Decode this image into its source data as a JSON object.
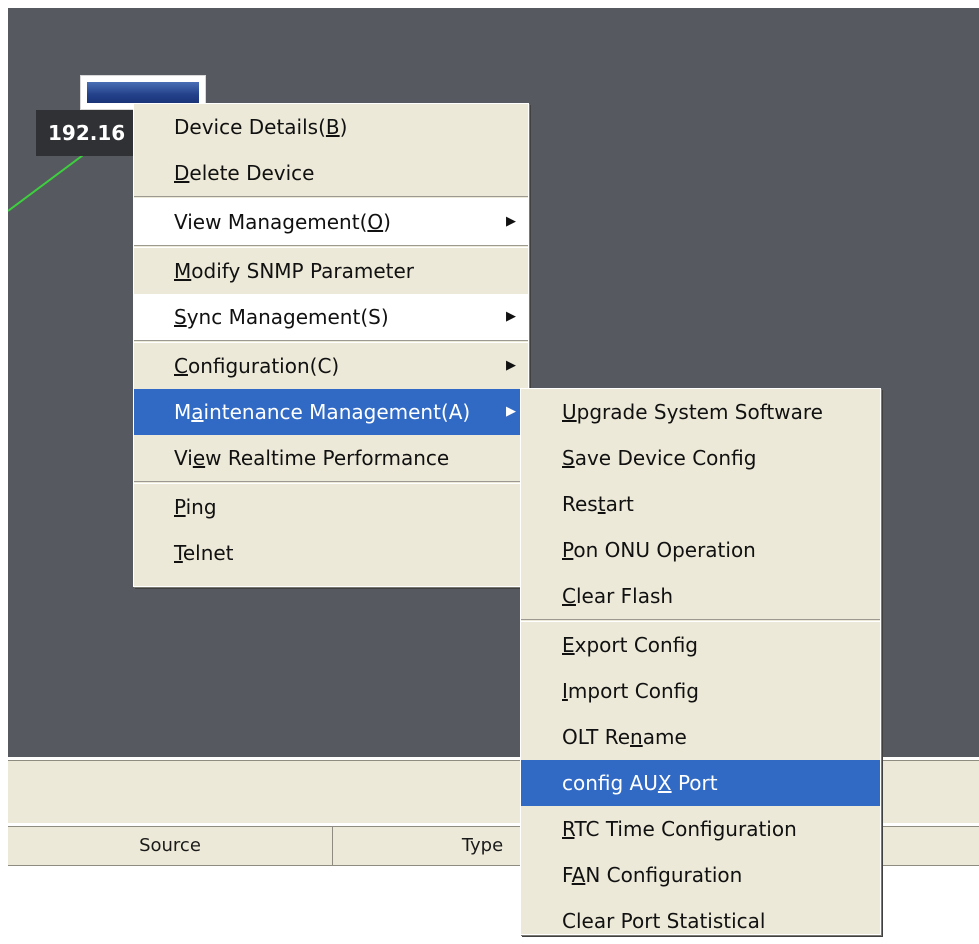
{
  "topology": {
    "device_label": "192.16"
  },
  "context_menu": {
    "items": [
      {
        "pre": "Device Details(",
        "mn": "B",
        "post": ")"
      },
      {
        "pre": "",
        "mn": "D",
        "post": "elete Device"
      },
      {
        "pre": "View Management(",
        "mn": "O",
        "post": ")"
      },
      {
        "pre": "",
        "mn": "M",
        "post": "odify SNMP Parameter"
      },
      {
        "pre": "",
        "mn": "S",
        "post": "ync Management(S)"
      },
      {
        "pre": "",
        "mn": "C",
        "post": "onfiguration(C)"
      },
      {
        "pre": "M",
        "mn": "a",
        "post": "intenance Management(A)"
      },
      {
        "pre": "Vi",
        "mn": "e",
        "post": "w Realtime Performance"
      },
      {
        "pre": "",
        "mn": "P",
        "post": "ing"
      },
      {
        "pre": "",
        "mn": "T",
        "post": "elnet"
      }
    ],
    "submenu_arrow": "▶"
  },
  "submenu": {
    "items": [
      {
        "pre": "",
        "mn": "U",
        "post": "pgrade System Software"
      },
      {
        "pre": "",
        "mn": "S",
        "post": "ave Device Config"
      },
      {
        "pre": "Res",
        "mn": "t",
        "post": "art"
      },
      {
        "pre": "",
        "mn": "P",
        "post": "on ONU Operation"
      },
      {
        "pre": "",
        "mn": "C",
        "post": "lear Flash"
      },
      {
        "pre": "",
        "mn": "E",
        "post": "xport Config"
      },
      {
        "pre": "",
        "mn": "I",
        "post": "mport Config"
      },
      {
        "pre": "OLT Re",
        "mn": "n",
        "post": "ame"
      },
      {
        "pre": "config AU",
        "mn": "X",
        "post": " Port"
      },
      {
        "pre": "",
        "mn": "R",
        "post": "TC Time Configuration"
      },
      {
        "pre": "F",
        "mn": "A",
        "post": "N Configuration"
      },
      {
        "pre": "Clear Port Statistical",
        "mn": "",
        "post": ""
      }
    ]
  },
  "table": {
    "columns": [
      "Source",
      "Type"
    ]
  },
  "colors": {
    "canvas": "#565a60",
    "menu_bg": "#ece9d8",
    "highlight": "#316ac5",
    "link_line": "#3cd13c"
  }
}
